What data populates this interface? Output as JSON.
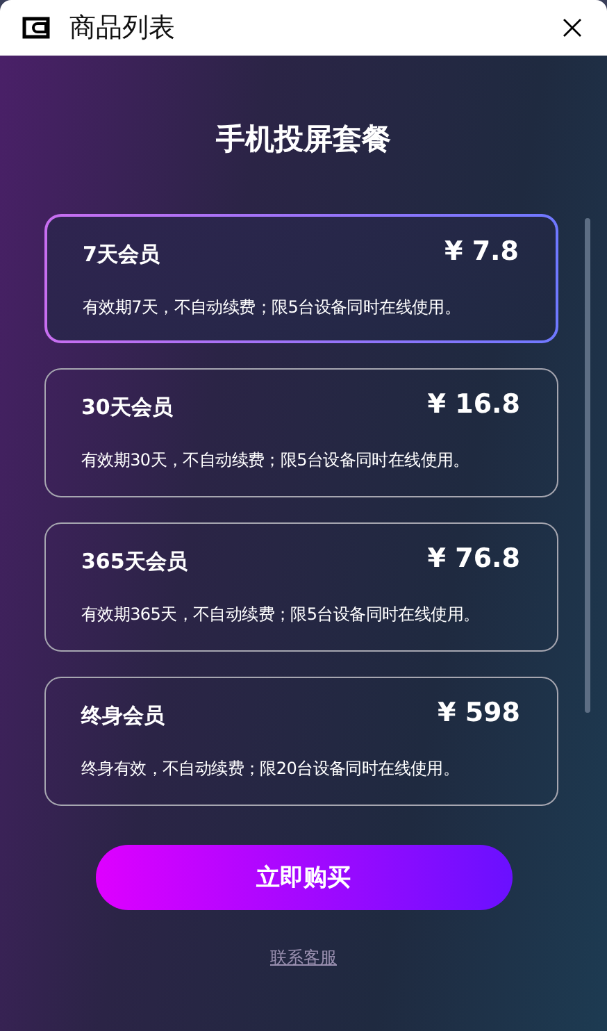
{
  "window": {
    "title": "商品列表"
  },
  "heading": "手机投屏套餐",
  "plans": [
    {
      "name": "7天会员",
      "price": "¥ 7.8",
      "description": "有效期7天，不自动续费；限5台设备同时在线使用。",
      "selected": true
    },
    {
      "name": "30天会员",
      "price": "¥ 16.8",
      "description": "有效期30天，不自动续费；限5台设备同时在线使用。",
      "selected": false
    },
    {
      "name": "365天会员",
      "price": "¥ 76.8",
      "description": "有效期365天，不自动续费；限5台设备同时在线使用。",
      "selected": false
    },
    {
      "name": "终身会员",
      "price": "¥ 598",
      "description": "终身有效，不自动续费；限20台设备同时在线使用。",
      "selected": false
    }
  ],
  "buy_button": "立即购买",
  "support_link": "联系客服"
}
